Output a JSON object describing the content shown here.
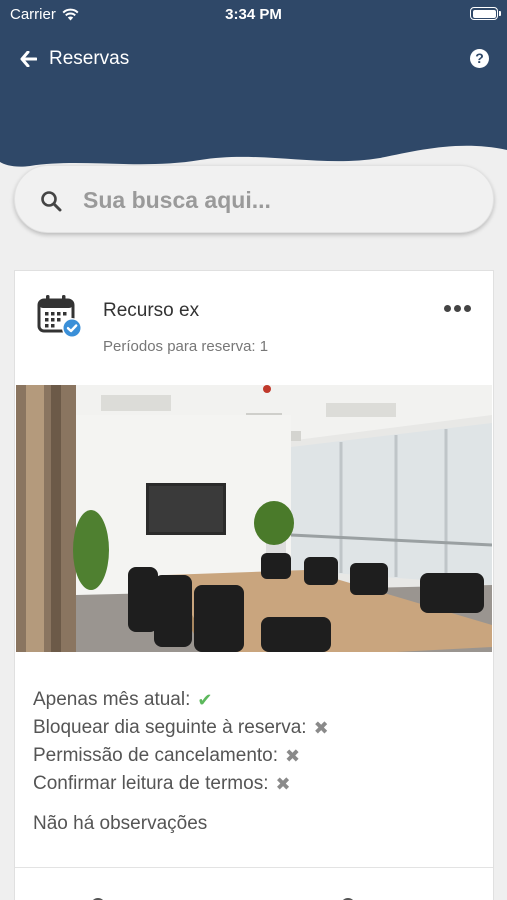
{
  "status_bar": {
    "carrier": "Carrier",
    "time": "3:34 PM"
  },
  "nav": {
    "title": "Reservas",
    "help": "?"
  },
  "search": {
    "placeholder": "Sua busca aqui..."
  },
  "resource": {
    "title": "Recurso ex",
    "periods": "Períodos para reserva: 1",
    "details": [
      {
        "label": "Apenas mês atual:",
        "value": "✔",
        "state": "yes"
      },
      {
        "label": "Bloquear dia seguinte à reserva:",
        "value": "✖",
        "state": "no"
      },
      {
        "label": "Permissão de cancelamento:",
        "value": "✖",
        "state": "no"
      },
      {
        "label": "Confirmar leitura de termos:",
        "value": "✖",
        "state": "no"
      }
    ],
    "observations": "Não há observações"
  },
  "colors": {
    "header": "#2f4868",
    "check": "#5cb85c",
    "badge": "#3a8fd8"
  },
  "icons": [
    "back-arrow-icon",
    "help-icon",
    "search-icon",
    "calendar-check-icon",
    "more-icon",
    "check-icon",
    "cross-icon"
  ]
}
